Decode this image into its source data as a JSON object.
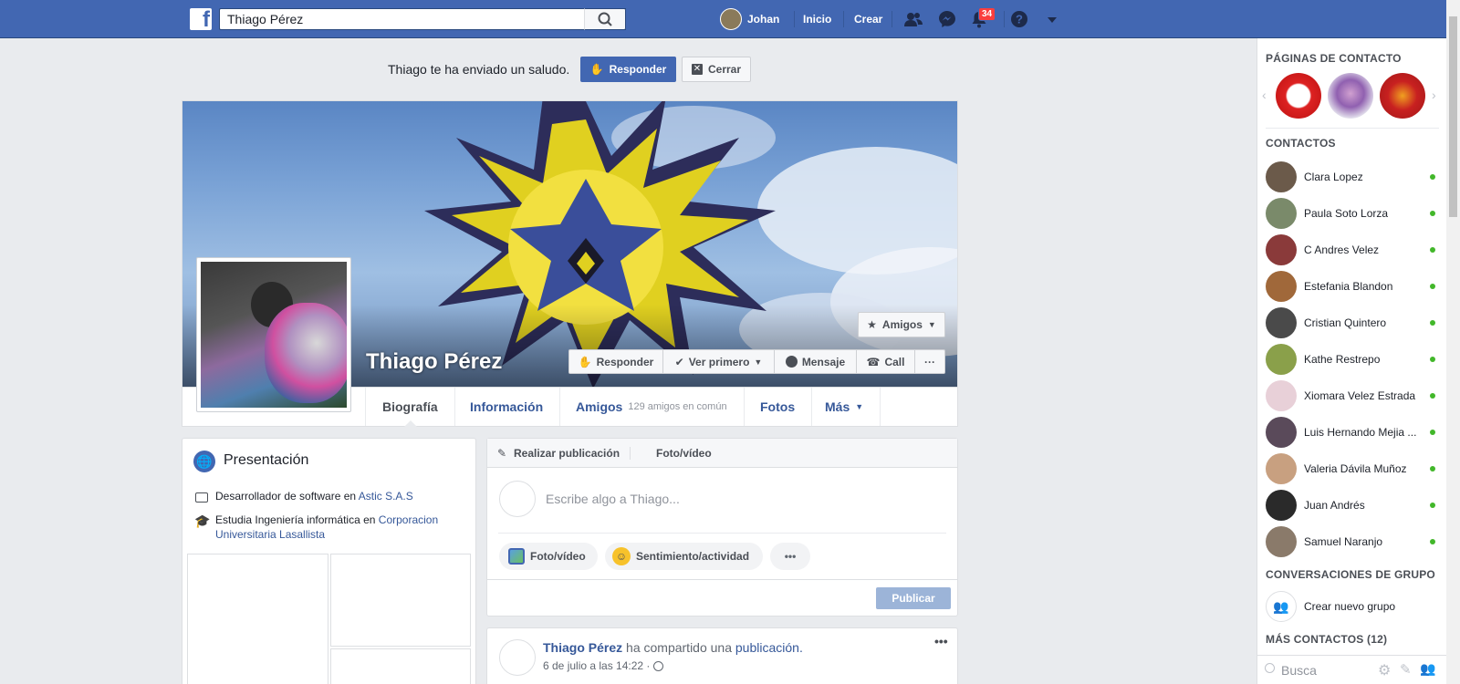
{
  "topbar": {
    "search_value": "Thiago Pérez",
    "user_name": "Johan",
    "nav_home": "Inicio",
    "nav_create": "Crear",
    "notifications_count": "34"
  },
  "greeting": {
    "text": "Thiago te ha enviado un saludo.",
    "reply_label": "Responder",
    "close_label": "Cerrar"
  },
  "profile": {
    "name": "Thiago Pérez",
    "friends_button": "Amigos",
    "actions": {
      "reply": "Responder",
      "see_first": "Ver primero",
      "message": "Mensaje",
      "call": "Call",
      "more": "···"
    },
    "tabs": {
      "timeline": "Biografía",
      "about": "Información",
      "friends": "Amigos",
      "friends_common": "129 amigos en común",
      "photos": "Fotos",
      "more": "Más"
    }
  },
  "intro": {
    "title": "Presentación",
    "work_prefix": "Desarrollador de software en",
    "work_place": "Astic S.A.S",
    "study_prefix": "Estudia Ingeniería informática en",
    "study_place": "Corporacion Universitaria Lasallista"
  },
  "composer": {
    "tab_post": "Realizar publicación",
    "tab_photo": "Foto/vídeo",
    "placeholder": "Escribe algo a Thiago...",
    "chip_photo": "Foto/vídeo",
    "chip_feeling": "Sentimiento/actividad",
    "chip_more": "•••",
    "publish": "Publicar"
  },
  "post": {
    "author": "Thiago Pérez",
    "action": "ha compartido una",
    "object": "publicación.",
    "time": "6 de julio a las 14:22 ·",
    "menu": "•••"
  },
  "sidebar": {
    "pages_heading": "PÁGINAS DE CONTACTO",
    "contacts_heading": "CONTACTOS",
    "contacts": [
      {
        "name": "Clara Lopez",
        "color": "#6b5a4a"
      },
      {
        "name": "Paula Soto Lorza",
        "color": "#7a8a6a"
      },
      {
        "name": "C Andres Velez",
        "color": "#8a3a3a"
      },
      {
        "name": "Estefania Blandon",
        "color": "#a0683a"
      },
      {
        "name": "Cristian Quintero",
        "color": "#4a4a4a"
      },
      {
        "name": "Kathe Restrepo",
        "color": "#8aa04a"
      },
      {
        "name": "Xiomara Velez Estrada",
        "color": "#e8d0d8"
      },
      {
        "name": "Luis Hernando Mejia ...",
        "color": "#5a4a5a"
      },
      {
        "name": "Valeria Dávila Muñoz",
        "color": "#c8a080"
      },
      {
        "name": "Juan Andrés",
        "color": "#2a2a2a"
      },
      {
        "name": "Samuel Naranjo",
        "color": "#8a7a6a"
      }
    ],
    "group_heading": "CONVERSACIONES DE GRUPO",
    "create_group": "Crear nuevo grupo",
    "more_contacts": "MÁS CONTACTOS (12)",
    "search_placeholder": "Busca"
  },
  "colors": {
    "brand": "#4267b2",
    "link": "#365899",
    "online": "#42b72a",
    "badge": "#fa3e3e"
  }
}
